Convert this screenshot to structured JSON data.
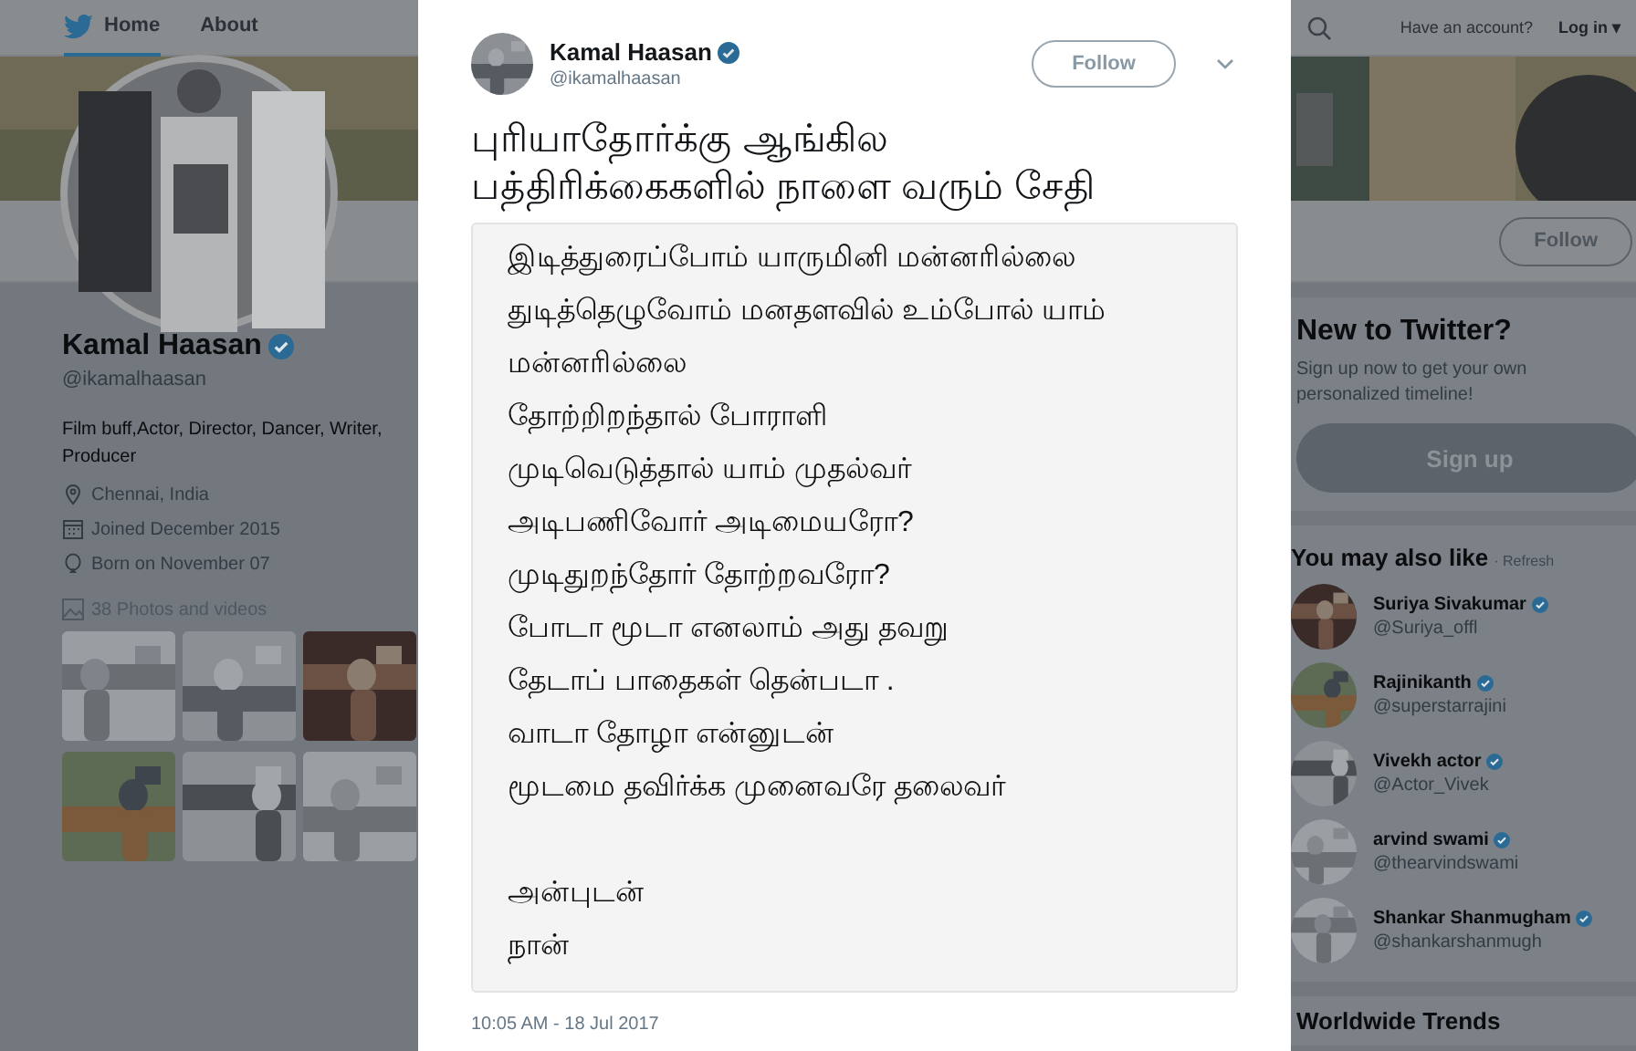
{
  "top_nav": {
    "items": [
      {
        "label": "Home",
        "selected": true
      },
      {
        "label": "About",
        "selected": false
      }
    ],
    "account_prompt": "Have an account?",
    "login": "Log in",
    "login_caret": "▾"
  },
  "profile_bar": {
    "follow": "Follow"
  },
  "profile": {
    "name": "Kamal Haasan",
    "verified": true,
    "handle": "@ikamalhaasan",
    "bio": "Film buff,Actor, Director, Dancer, Writer, Producer",
    "details": [
      {
        "kind": "location",
        "text": "Chennai, India"
      },
      {
        "kind": "joined",
        "text": "Joined December 2015"
      },
      {
        "kind": "birthday",
        "text": "Born on November 07"
      }
    ],
    "media_link": "38 Photos and videos"
  },
  "signup_card": {
    "title": "New to Twitter?",
    "text": "Sign up now to get your own personalized timeline!",
    "button": "Sign up"
  },
  "suggestions": {
    "title": "You may also like",
    "refresh": "· Refresh",
    "accounts": [
      {
        "name": "Suriya Sivakumar",
        "handle": "@Suriya_offl",
        "verified": true
      },
      {
        "name": "Rajinikanth",
        "handle": "@superstarrajini",
        "verified": true
      },
      {
        "name": "Vivekh actor",
        "handle": "@Actor_Vivek",
        "verified": true
      },
      {
        "name": "arvind swami",
        "handle": "@thearvindswami",
        "verified": true
      },
      {
        "name": "Shankar Shanmugham",
        "handle": "@shankarshanmugh",
        "verified": true
      }
    ]
  },
  "trends": {
    "title": "Worldwide Trends"
  },
  "tweet": {
    "name": "Kamal Haasan",
    "verified": true,
    "handle": "@ikamalhaasan",
    "follow": "Follow",
    "text_lines": [
      "புரியாதோர்க்கு ஆங்கில",
      "பத்திரிக்கைகளில்  நாளை வரும் சேதி"
    ],
    "image_verses": [
      "இடித்துரைப்போம் யாருமினி மன்னரில்லை",
      "துடித்தெழுவோம் மனதளவில் உம்போல் யாம்",
      "மன்னரில்லை",
      "தோற்றிறந்தால் போராளி",
      "முடிவெடுத்தால் யாம் முதல்வர்",
      "அடிபணிவோர் அடிமையரோ?",
      "முடிதுறந்தோர் தோற்றவரோ?",
      "போடா மூடா எனலாம் அது தவறு",
      "தேடாப் பாதைகள் தென்படா .",
      "வாடா தோழா என்னுடன்",
      "மூடமை தவிர்க்க முனைவரே தலைவர்"
    ],
    "image_signoff": [
      "அன்புடன்",
      "நான்"
    ],
    "timestamp": "10:05 AM - 18 Jul 2017"
  }
}
